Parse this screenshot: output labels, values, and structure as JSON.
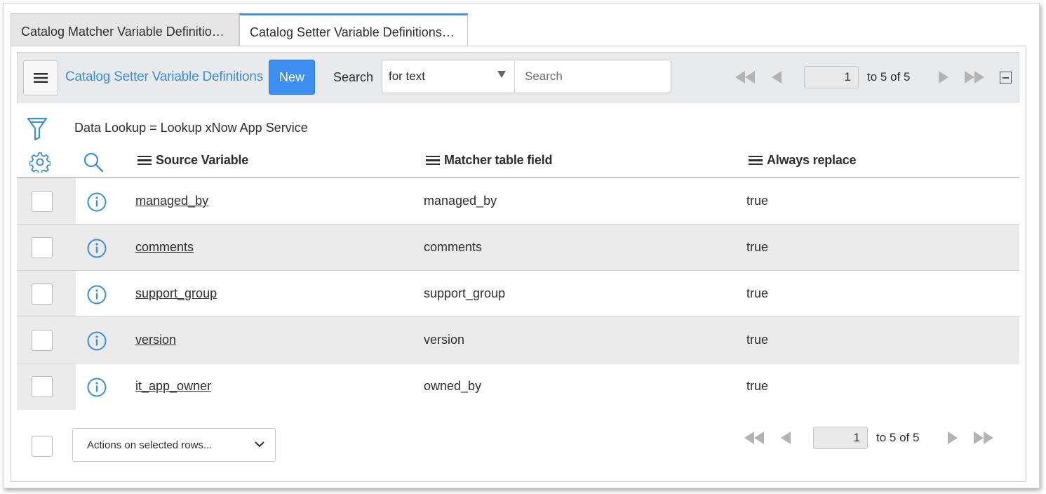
{
  "tabs": [
    {
      "label": "Catalog Matcher Variable Definitio…",
      "active": false
    },
    {
      "label": "Catalog Setter Variable Definitions…",
      "active": true
    }
  ],
  "toolbar": {
    "title": "Catalog Setter Variable Definitions",
    "new_label": "New",
    "search_label": "Search",
    "search_field_selected": "for text",
    "search_placeholder": "Search"
  },
  "pager_top": {
    "page": "1",
    "range": "to 5 of 5"
  },
  "pager_bottom": {
    "page": "1",
    "range": "to 5 of 5"
  },
  "filter": {
    "text": "Data Lookup = Lookup xNow App Service"
  },
  "columns": [
    "Source Variable",
    "Matcher table field",
    "Always replace"
  ],
  "rows": [
    {
      "source_variable": "managed_by",
      "matcher_field": "managed_by",
      "always_replace": "true"
    },
    {
      "source_variable": "comments",
      "matcher_field": "comments",
      "always_replace": "true"
    },
    {
      "source_variable": "support_group",
      "matcher_field": "support_group",
      "always_replace": "true"
    },
    {
      "source_variable": "version",
      "matcher_field": "version",
      "always_replace": "true"
    },
    {
      "source_variable": "it_app_owner",
      "matcher_field": "owned_by",
      "always_replace": "true"
    }
  ],
  "footer": {
    "actions_label": "Actions on selected rows..."
  },
  "colors": {
    "accent": "#3b8ed8",
    "new_button": "#3c8ef0",
    "tab_active_border": "#4a90d9"
  }
}
